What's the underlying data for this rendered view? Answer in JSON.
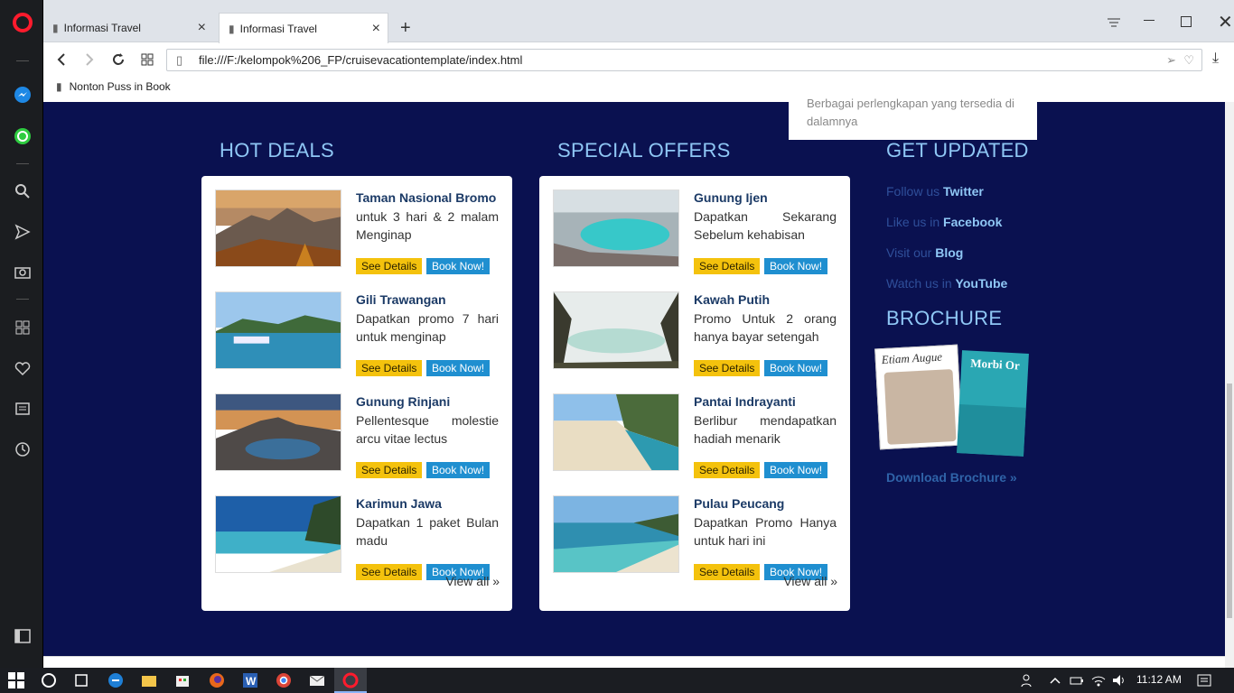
{
  "browser": {
    "tabs": [
      {
        "label": "Informasi Travel"
      },
      {
        "label": "Informasi Travel"
      }
    ],
    "address": "file:///F:/kelompok%206_FP/cruisevacationtemplate/index.html",
    "bookmark": "Nonton Puss in Book"
  },
  "popup": {
    "text": "Berbagai perlengkapan yang tersedia di dalamnya"
  },
  "hot_deals": {
    "heading": "HOT DEALS",
    "items": [
      {
        "title": "Taman Nasional Bromo",
        "desc": "untuk 3 hari & 2 malam Menginap"
      },
      {
        "title": "Gili Trawangan",
        "desc": "Dapatkan promo 7 hari untuk menginap"
      },
      {
        "title": "Gunung Rinjani",
        "desc": "Pellentesque molestie arcu vitae lectus"
      },
      {
        "title": "Karimun Jawa",
        "desc": "Dapatkan 1 paket Bulan madu"
      }
    ],
    "view_all": "View all »"
  },
  "special_offers": {
    "heading": "SPECIAL OFFERS",
    "items": [
      {
        "title": "Gunung Ijen",
        "desc": "Dapatkan Sekarang Sebelum kehabisan"
      },
      {
        "title": "Kawah Putih",
        "desc": "Promo Untuk 2 orang hanya bayar setengah"
      },
      {
        "title": "Pantai Indrayanti",
        "desc": "Berlibur mendapatkan hadiah menarik"
      },
      {
        "title": "Pulau Peucang",
        "desc": "Dapatkan Promo Hanya untuk hari ini"
      }
    ],
    "view_all": "View all »"
  },
  "buttons": {
    "see": "See Details",
    "book": "Book Now!"
  },
  "updated": {
    "heading": "GET UPDATED",
    "links": [
      {
        "prefix": "Follow us ",
        "name": "Twitter"
      },
      {
        "prefix": "Like us in ",
        "name": "Facebook"
      },
      {
        "prefix": "Visit our ",
        "name": "Blog"
      },
      {
        "prefix": "Watch us in ",
        "name": "YouTube"
      }
    ]
  },
  "brochure": {
    "heading": "BROCHURE",
    "cover1": "Etiam Augue",
    "cover2": "Morbi Or",
    "download": "Download Brochure »"
  },
  "taskbar": {
    "time": "11:12 AM"
  }
}
